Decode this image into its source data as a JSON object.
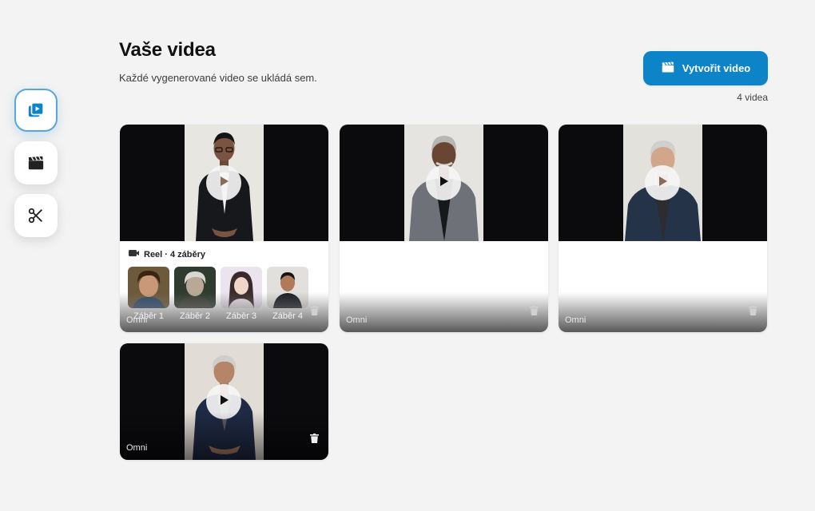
{
  "header": {
    "title": "Vaše videa",
    "subtitle": "Každé vygenerované video se ukládá sem.",
    "create_label": "Vytvořit video",
    "count": "4 videa"
  },
  "rail": {
    "items": [
      {
        "icon": "video-library-icon",
        "active": true
      },
      {
        "icon": "clapperboard-icon",
        "active": false
      },
      {
        "icon": "scissors-icon",
        "active": false
      }
    ]
  },
  "colors": {
    "accent": "#0e84c8",
    "background": "#f3f3f3",
    "thumb_bg": "#0b0b0e"
  },
  "videos": [
    {
      "tag": "Omni",
      "reel": {
        "label": "Reel · 4 záběry",
        "scenes": [
          "Záběr 1",
          "Záběr 2",
          "Záběr 3",
          "Záběr 4"
        ]
      }
    },
    {
      "tag": "Omni"
    },
    {
      "tag": "Omni"
    },
    {
      "tag": "Omni"
    }
  ]
}
